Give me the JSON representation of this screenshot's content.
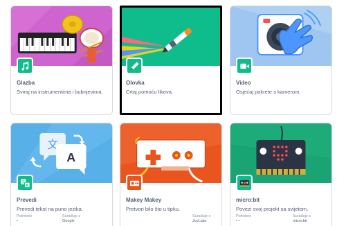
{
  "cards": [
    {
      "title": "Glazba",
      "description": "Sviraj na instrumentima i bubnjevima.",
      "icon": "music-notes-icon",
      "banner_color": "#cf63cf",
      "icon_bg": "#0fbd8c",
      "selected": false
    },
    {
      "title": "Olovka",
      "description": "Crtaj pomoću likova.",
      "icon": "pencil-icon",
      "banner_color": "#0fbd8c",
      "icon_bg": "#0fbd8c",
      "selected": true
    },
    {
      "title": "Video",
      "description": "Osjećaj pokrete s kamerom.",
      "icon": "video-camera-icon",
      "banner_color": "#9ec6f0",
      "icon_bg": "#0fbd8c",
      "selected": false
    },
    {
      "title": "Prevedi",
      "description": "Prevedi tekst na puno jezika.",
      "icon": "translate-icon",
      "banner_color": "#58b0e8",
      "icon_bg": "#0fbd8c",
      "selected": false,
      "requirements": [
        {
          "label": "Potrebno",
          "value": "•"
        },
        {
          "label": "Surađuje s",
          "value": "Google"
        }
      ]
    },
    {
      "title": "Makey Makey",
      "description": "Pretvori bilo što u tipku.",
      "icon": "makey-makey-icon",
      "banner_color": "#e9541f",
      "icon_bg": "#e9541f",
      "selected": false,
      "requirements": [
        {
          "label": "Surađuje s",
          "value": "JoyLabz"
        }
      ]
    },
    {
      "title": "micro:bit",
      "description": "Povezi svoj projekt sa svijetom.",
      "icon": "microbit-icon",
      "banner_color": "#1aa373",
      "icon_bg": "#0fbd8c",
      "selected": false,
      "requirements": [
        {
          "label": "Potrebno",
          "value": "• •"
        },
        {
          "label": "Surađuje s",
          "value": "micro:bit"
        }
      ]
    }
  ]
}
